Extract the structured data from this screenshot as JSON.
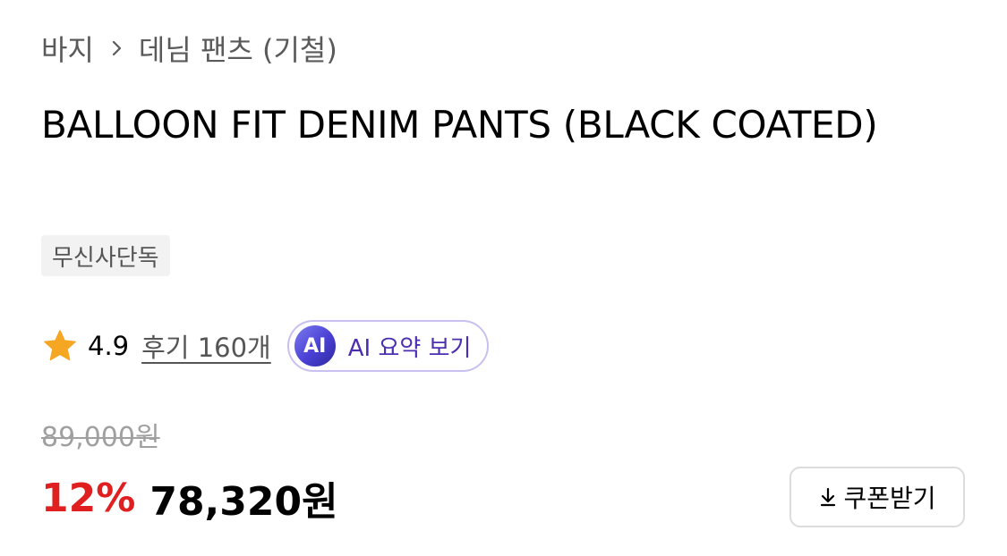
{
  "breadcrumb": {
    "parent": "바지",
    "current": "데님 팬츠 (기철)"
  },
  "product": {
    "title": "BALLOON FIT DENIM PANTS (BLACK COATED)",
    "badge": "무신사단독"
  },
  "rating": {
    "score": "4.9",
    "reviews": "후기 160개",
    "ai_badge": "AI",
    "ai_summary_label": "AI 요약 보기"
  },
  "price": {
    "original": "89,000원",
    "discount": "12%",
    "sale": "78,320원"
  },
  "coupon": {
    "label": "쿠폰받기"
  },
  "icons": {
    "breadcrumb_separator": "chevron-right-icon",
    "rating": "star-icon",
    "coupon": "download-icon"
  },
  "colors": {
    "star": "#f5a623",
    "discount": "#e02020",
    "ai_accent": "#4b2fb0",
    "ai_border": "#c9bff0"
  }
}
